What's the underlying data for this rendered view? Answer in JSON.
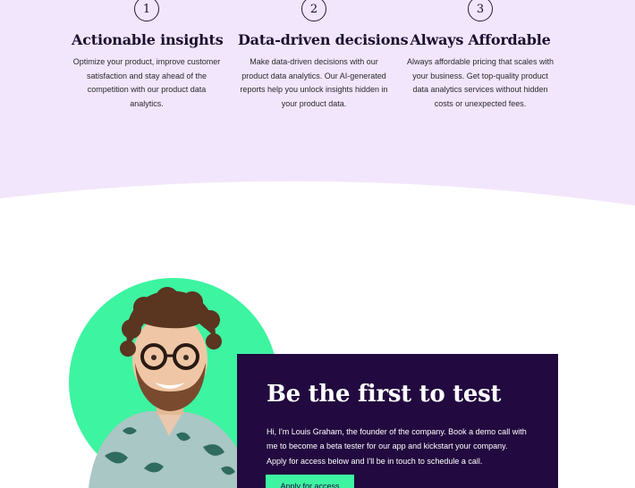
{
  "features": [
    {
      "number": "1",
      "title": "Actionable insights",
      "desc_lines": [
        "Optimize your product, improve customer",
        "satisfaction and stay ahead of the",
        "competition with our product data",
        "analytics."
      ]
    },
    {
      "number": "2",
      "title": "Data-driven decisions",
      "desc_lines": [
        "Make data-driven decisions with our",
        "product data analytics. Our AI-generated",
        "reports help you unlock insights hidden in",
        "your product data."
      ]
    },
    {
      "number": "3",
      "title": "Always Affordable",
      "desc_lines": [
        "Always affordable pricing that scales with",
        "your business. Get top-quality product",
        "data analytics services without hidden",
        "costs or unexpected fees."
      ]
    }
  ],
  "cta_section": {
    "title": "Be the first to test",
    "body_lines": [
      "Hi, I'm Louis Graham, the founder of the company. Book a demo call with",
      "me to become a beta tester for our app and kickstart your company.",
      "Apply for access below and I'll be in touch to schedule a call."
    ],
    "button_label": "Apply for access"
  },
  "colors": {
    "lavender_bg": "#f2e6fd",
    "dark_purple": "#22093f",
    "mint_accent": "#3df4a1"
  }
}
